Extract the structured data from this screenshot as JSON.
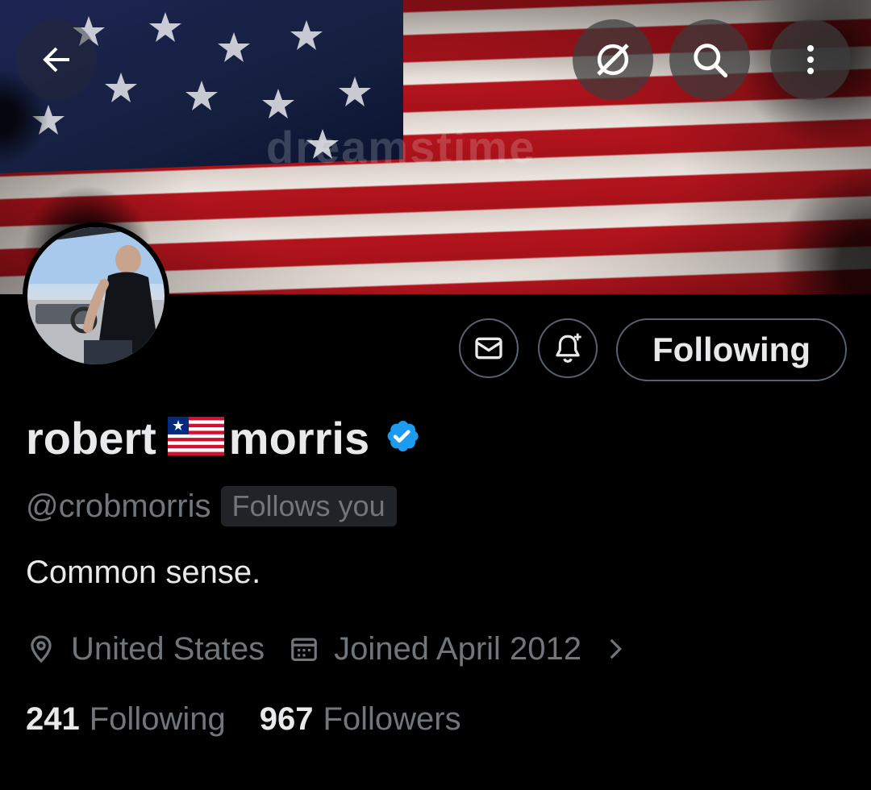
{
  "banner": {
    "watermark": "dreamstime"
  },
  "nav": {
    "back_icon": "arrow-left-icon",
    "grok_icon": "grok-icon",
    "search_icon": "search-icon",
    "more_icon": "more-vertical-icon"
  },
  "profile": {
    "name_first": "robert",
    "name_last": "morris",
    "flag_emoji": "liberia-flag",
    "verified": true,
    "handle": "@crobmorris",
    "follows_you": "Follows you",
    "bio": "Common sense.",
    "location": "United States",
    "joined": "Joined April 2012"
  },
  "actions": {
    "following_label": "Following"
  },
  "stats": {
    "following_count": "241",
    "following_label": "Following",
    "followers_count": "967",
    "followers_label": "Followers"
  },
  "colors": {
    "background": "#000000",
    "text_primary": "#e7e9ea",
    "text_secondary": "#71767b",
    "border": "#536471",
    "verified_blue": "#1d9bf0"
  }
}
